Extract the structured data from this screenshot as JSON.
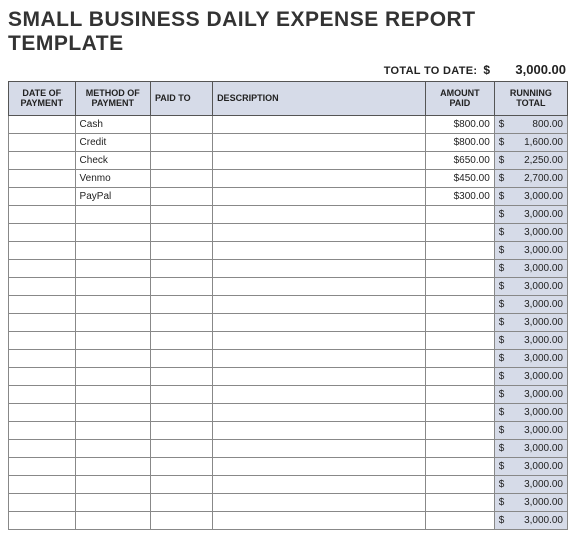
{
  "title": "SMALL BUSINESS DAILY EXPENSE REPORT TEMPLATE",
  "total": {
    "label": "TOTAL TO DATE:",
    "currency": "$",
    "value": "3,000.00"
  },
  "columns": {
    "date": "DATE OF PAYMENT",
    "method": "METHOD OF PAYMENT",
    "paidto": "PAID TO",
    "desc": "DESCRIPTION",
    "amount": "AMOUNT PAID",
    "running": "RUNNING TOTAL"
  },
  "rows": [
    {
      "date": "",
      "method": "Cash",
      "paidto": "",
      "desc": "",
      "amount": "$800.00",
      "rsym": "$",
      "rval": "800.00"
    },
    {
      "date": "",
      "method": "Credit",
      "paidto": "",
      "desc": "",
      "amount": "$800.00",
      "rsym": "$",
      "rval": "1,600.00"
    },
    {
      "date": "",
      "method": "Check",
      "paidto": "",
      "desc": "",
      "amount": "$650.00",
      "rsym": "$",
      "rval": "2,250.00"
    },
    {
      "date": "",
      "method": "Venmo",
      "paidto": "",
      "desc": "",
      "amount": "$450.00",
      "rsym": "$",
      "rval": "2,700.00"
    },
    {
      "date": "",
      "method": "PayPal",
      "paidto": "",
      "desc": "",
      "amount": "$300.00",
      "rsym": "$",
      "rval": "3,000.00"
    },
    {
      "date": "",
      "method": "",
      "paidto": "",
      "desc": "",
      "amount": "",
      "rsym": "$",
      "rval": "3,000.00"
    },
    {
      "date": "",
      "method": "",
      "paidto": "",
      "desc": "",
      "amount": "",
      "rsym": "$",
      "rval": "3,000.00"
    },
    {
      "date": "",
      "method": "",
      "paidto": "",
      "desc": "",
      "amount": "",
      "rsym": "$",
      "rval": "3,000.00"
    },
    {
      "date": "",
      "method": "",
      "paidto": "",
      "desc": "",
      "amount": "",
      "rsym": "$",
      "rval": "3,000.00"
    },
    {
      "date": "",
      "method": "",
      "paidto": "",
      "desc": "",
      "amount": "",
      "rsym": "$",
      "rval": "3,000.00"
    },
    {
      "date": "",
      "method": "",
      "paidto": "",
      "desc": "",
      "amount": "",
      "rsym": "$",
      "rval": "3,000.00"
    },
    {
      "date": "",
      "method": "",
      "paidto": "",
      "desc": "",
      "amount": "",
      "rsym": "$",
      "rval": "3,000.00"
    },
    {
      "date": "",
      "method": "",
      "paidto": "",
      "desc": "",
      "amount": "",
      "rsym": "$",
      "rval": "3,000.00"
    },
    {
      "date": "",
      "method": "",
      "paidto": "",
      "desc": "",
      "amount": "",
      "rsym": "$",
      "rval": "3,000.00"
    },
    {
      "date": "",
      "method": "",
      "paidto": "",
      "desc": "",
      "amount": "",
      "rsym": "$",
      "rval": "3,000.00"
    },
    {
      "date": "",
      "method": "",
      "paidto": "",
      "desc": "",
      "amount": "",
      "rsym": "$",
      "rval": "3,000.00"
    },
    {
      "date": "",
      "method": "",
      "paidto": "",
      "desc": "",
      "amount": "",
      "rsym": "$",
      "rval": "3,000.00"
    },
    {
      "date": "",
      "method": "",
      "paidto": "",
      "desc": "",
      "amount": "",
      "rsym": "$",
      "rval": "3,000.00"
    },
    {
      "date": "",
      "method": "",
      "paidto": "",
      "desc": "",
      "amount": "",
      "rsym": "$",
      "rval": "3,000.00"
    },
    {
      "date": "",
      "method": "",
      "paidto": "",
      "desc": "",
      "amount": "",
      "rsym": "$",
      "rval": "3,000.00"
    },
    {
      "date": "",
      "method": "",
      "paidto": "",
      "desc": "",
      "amount": "",
      "rsym": "$",
      "rval": "3,000.00"
    },
    {
      "date": "",
      "method": "",
      "paidto": "",
      "desc": "",
      "amount": "",
      "rsym": "$",
      "rval": "3,000.00"
    },
    {
      "date": "",
      "method": "",
      "paidto": "",
      "desc": "",
      "amount": "",
      "rsym": "$",
      "rval": "3,000.00"
    }
  ]
}
